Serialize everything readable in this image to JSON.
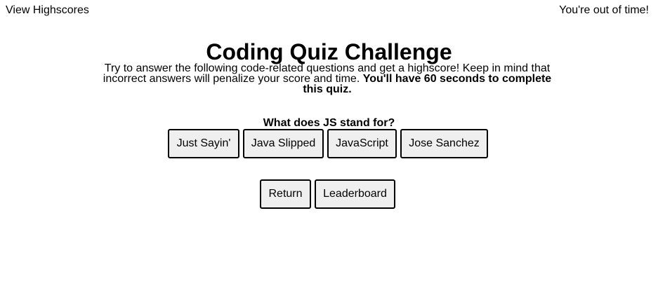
{
  "header": {
    "view_highscores": "View Highscores",
    "timer_status": "You're out of time!"
  },
  "intro": {
    "title": "Coding Quiz Challenge",
    "description": "Try to answer the following code-related questions and get a highscore! Keep in mind that incorrect answers will penalize your score and time.",
    "emphasis": "You'll have 60 seconds to complete this quiz."
  },
  "quiz": {
    "question": "What does JS stand for?",
    "answers": [
      "Just Sayin'",
      "Java Slipped",
      "JavaScript",
      "Jose Sanchez"
    ]
  },
  "actions": {
    "return_label": "Return",
    "leaderboard_label": "Leaderboard"
  },
  "colors": {
    "button_background": "#efefef",
    "button_border": "#000000",
    "text": "#000000",
    "background": "#ffffff"
  }
}
